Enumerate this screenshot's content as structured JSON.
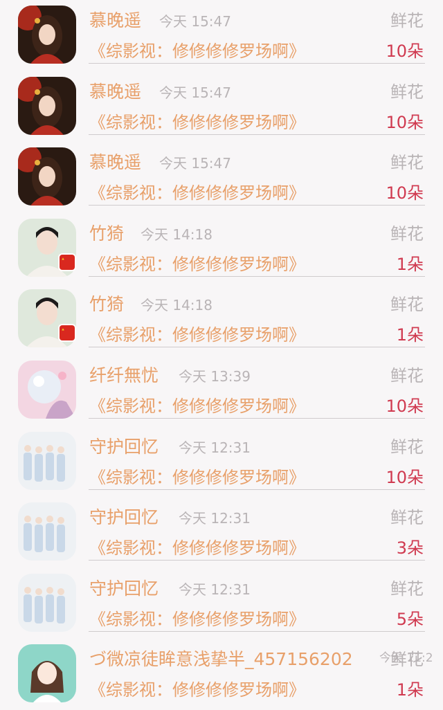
{
  "rows": [
    {
      "name": "慕晚遥",
      "time": "今天 15:47",
      "type": "鲜花",
      "title": "《综影视：修修修修罗场啊》",
      "count": "10朵",
      "avatar": "girl-red-icon"
    },
    {
      "name": "慕晚遥",
      "time": "今天 15:47",
      "type": "鲜花",
      "title": "《综影视：修修修修罗场啊》",
      "count": "10朵",
      "avatar": "girl-red-icon"
    },
    {
      "name": "慕晚遥",
      "time": "今天 15:47",
      "type": "鲜花",
      "title": "《综影视：修修修修罗场啊》",
      "count": "10朵",
      "avatar": "girl-red-icon"
    },
    {
      "name": "竹猗",
      "time": "今天 14:18",
      "type": "鲜花",
      "title": "《综影视：修修修修罗场啊》",
      "count": "1朵",
      "avatar": "man-portrait-icon"
    },
    {
      "name": "竹猗",
      "time": "今天 14:18",
      "type": "鲜花",
      "title": "《综影视：修修修修罗场啊》",
      "count": "1朵",
      "avatar": "man-portrait-icon"
    },
    {
      "name": "纤纤無忧",
      "time": "今天 13:39",
      "type": "鲜花",
      "title": "《综影视：修修修修罗场啊》",
      "count": "10朵",
      "avatar": "crystal-ball-icon"
    },
    {
      "name": "守护回忆",
      "time": "今天 12:31",
      "type": "鲜花",
      "title": "《综影视：修修修修罗场啊》",
      "count": "10朵",
      "avatar": "group-photo-icon"
    },
    {
      "name": "守护回忆",
      "time": "今天 12:31",
      "type": "鲜花",
      "title": "《综影视：修修修修罗场啊》",
      "count": "3朵",
      "avatar": "group-photo-icon"
    },
    {
      "name": "守护回忆",
      "time": "今天 12:31",
      "type": "鲜花",
      "title": "《综影视：修修修修罗场啊》",
      "count": "5朵",
      "avatar": "group-photo-icon"
    },
    {
      "name": "づ微凉徒眸意浅挚半_457156202",
      "time": "今天 11:2",
      "type": "鲜花",
      "title": "《综影视：修修修修罗场啊》",
      "count": "1朵",
      "avatar": "cartoon-girl-icon"
    }
  ],
  "colors": {
    "name": "#e8a06a",
    "count": "#d03a50",
    "muted": "#b9b4b6",
    "background": "#f8f6f7"
  }
}
